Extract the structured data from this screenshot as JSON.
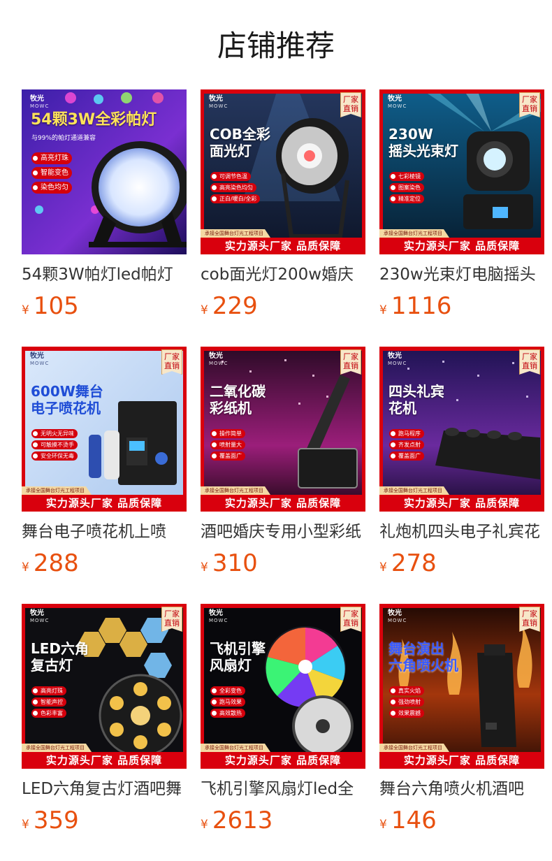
{
  "section_title": "店铺推荐",
  "brand": {
    "name": "牧光",
    "sub": "MOWC"
  },
  "badge": "厂家\n直销",
  "banner": "实力源头厂家 品质保障",
  "ribbon": "承接全国舞台灯光工程项目",
  "currency": "¥",
  "products": [
    {
      "title": "54颗3W帕灯led帕灯",
      "price": "105",
      "headline": "54颗3W全彩帕灯",
      "subline": "与99%的帕灯通道兼容",
      "features": [
        "高亮灯珠",
        "智能变色",
        "染色均匀"
      ]
    },
    {
      "title": "cob面光灯200w婚庆",
      "price": "229",
      "headline": "COB全彩\n面光灯",
      "features": [
        "可调节色温",
        "高亮染色均匀",
        "正白/暖白/全彩"
      ]
    },
    {
      "title": "230w光束灯电脑摇头",
      "price": "1116",
      "headline": "230W\n摇头光束灯",
      "features": [
        "七彩棱镜",
        "图案染色",
        "精准定位"
      ]
    },
    {
      "title": "舞台电子喷花机上喷",
      "price": "288",
      "headline": "600W舞台\n电子喷花机",
      "features": [
        "无明火无异味",
        "可触摸不烫手",
        "安全环保无毒"
      ]
    },
    {
      "title": "酒吧婚庆专用小型彩纸",
      "price": "310",
      "headline": "二氧化碳\n彩纸机",
      "features": [
        "操作简单",
        "喷射量大",
        "覆盖面广"
      ]
    },
    {
      "title": "礼炮机四头电子礼宾花",
      "price": "278",
      "headline": "四头礼宾\n花机",
      "features": [
        "跑马程序",
        "齐发点射",
        "覆盖面广"
      ]
    },
    {
      "title": "LED六角复古灯酒吧舞",
      "price": "359",
      "headline": "LED六角\n复古灯",
      "features": [
        "高亮灯珠",
        "智能声控",
        "色彩丰富"
      ]
    },
    {
      "title": "飞机引擎风扇灯led全",
      "price": "2613",
      "headline": "飞机引擎\n风扇灯",
      "features": [
        "全彩变色",
        "跑马效果",
        "高效散热"
      ]
    },
    {
      "title": "舞台六角喷火机酒吧",
      "price": "146",
      "headline": "舞台演出\n六角喷火机",
      "features": [
        "真实火焰",
        "强劲喷射",
        "效果震撼"
      ]
    }
  ]
}
